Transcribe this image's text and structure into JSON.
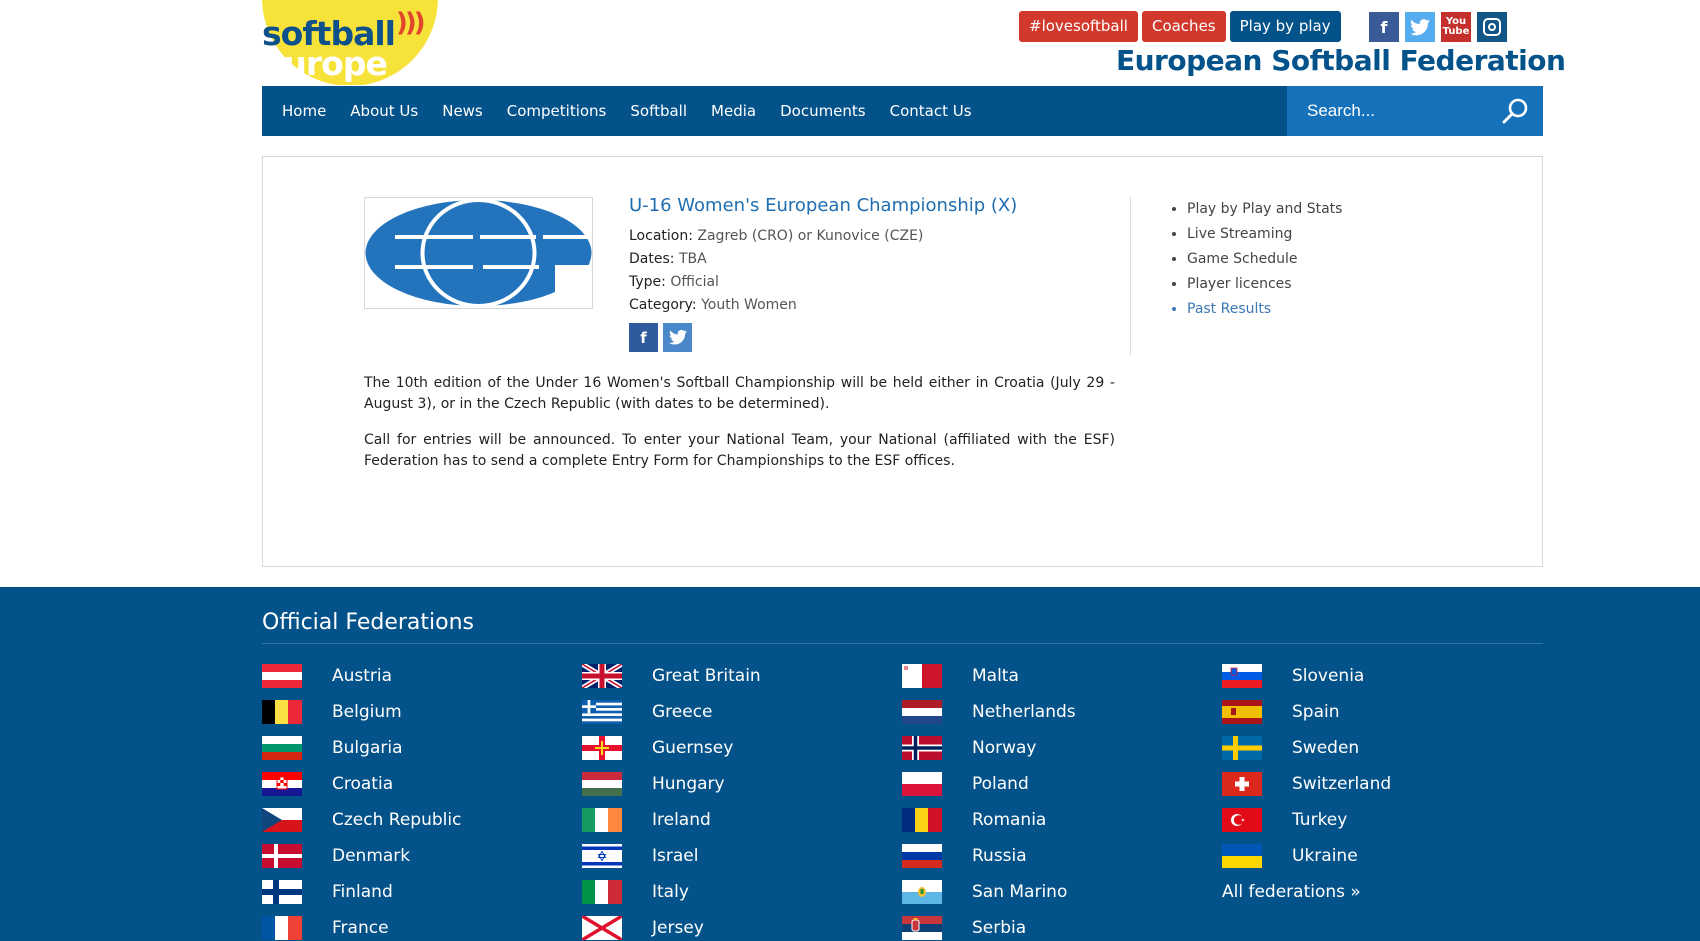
{
  "header": {
    "logo_line1": "softball",
    "logo_line2": "europe",
    "logo_marks": ")))",
    "buttons": [
      {
        "label": "#lovesoftball",
        "color": "#d0392b"
      },
      {
        "label": "Coaches",
        "color": "#d0392b"
      },
      {
        "label": "Play by play",
        "color": "#03528a"
      }
    ],
    "social": {
      "facebook": "f",
      "twitter": "t",
      "youtube_line1": "You",
      "youtube_line2": "Tube"
    },
    "federation_title": "European Softball Federation"
  },
  "nav": {
    "items": [
      "Home",
      "About Us",
      "News",
      "Competitions",
      "Softball",
      "Media",
      "Documents",
      "Contact Us"
    ],
    "search_placeholder": "Search..."
  },
  "event": {
    "title": "U-16 Women's European Championship (X)",
    "location_label": "Location:",
    "location_value": "Zagreb (CRO) or Kunovice (CZE)",
    "dates_label": "Dates:",
    "dates_value": "TBA",
    "type_label": "Type:",
    "type_value": "Official",
    "category_label": "Category:",
    "category_value": "Youth Women",
    "share_fb": "f",
    "share_tw": "t",
    "links": [
      "Play by Play and Stats",
      "Live Streaming",
      "Game Schedule",
      "Player licences",
      "Past Results"
    ],
    "paragraph1": "The 10th edition of the Under 16 Women's Softball Championship will be held either in Croatia (July 29 - August 3), or in the Czech Republic (with dates to be determined).",
    "paragraph2": "Call for entries will be announced. To enter your National Team, your National (affiliated with the ESF) Federation has to send a complete Entry Form for Championships to the ESF offices."
  },
  "footer": {
    "title": "Official Federations",
    "columns": [
      [
        "Austria",
        "Belgium",
        "Bulgaria",
        "Croatia",
        "Czech Republic",
        "Denmark",
        "Finland",
        "France"
      ],
      [
        "Great Britain",
        "Greece",
        "Guernsey",
        "Hungary",
        "Ireland",
        "Israel",
        "Italy",
        "Jersey"
      ],
      [
        "Malta",
        "Netherlands",
        "Norway",
        "Poland",
        "Romania",
        "Russia",
        "San Marino",
        "Serbia"
      ],
      [
        "Slovenia",
        "Spain",
        "Sweden",
        "Switzerland",
        "Turkey",
        "Ukraine"
      ]
    ],
    "all_link": "All federations »"
  }
}
